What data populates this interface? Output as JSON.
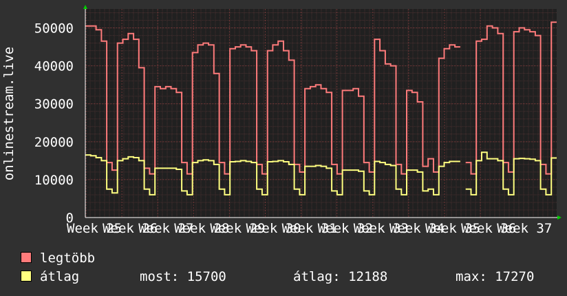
{
  "chart_data": {
    "type": "line",
    "ylabel": "onlinestream.live",
    "ylim": [
      0,
      55000
    ],
    "yticks": [
      0,
      10000,
      20000,
      30000,
      40000,
      50000
    ],
    "xticks": [
      "Week 25",
      "Week 26",
      "Week 27",
      "Week 28",
      "Week 29",
      "Week 30",
      "Week 31",
      "Week 32",
      "Week 33",
      "Week 34",
      "Week 35",
      "Week 36",
      "Week 37"
    ],
    "grid": true,
    "colors": {
      "background": "#303030",
      "plot_bg": "#202020",
      "grid_minor": "#4a3030",
      "grid_major": "#6a3434",
      "max_series": "#ff7b7b",
      "avg_series": "#ffff80",
      "arrow": "#00cc00"
    },
    "series": [
      {
        "name": "legtöbb",
        "color": "#ff7b7b",
        "values": [
          50500,
          50500,
          49500,
          46500,
          14500,
          12500,
          46000,
          47000,
          48500,
          47000,
          39500,
          13000,
          11500,
          34500,
          34000,
          34500,
          34000,
          33000,
          14500,
          11500,
          43500,
          45500,
          46000,
          45500,
          38000,
          14500,
          11500,
          44500,
          45000,
          45500,
          45000,
          44000,
          14000,
          11500,
          44000,
          45500,
          46500,
          44000,
          41500,
          14000,
          12000,
          34000,
          34500,
          35000,
          34000,
          33000,
          14000,
          11500,
          33500,
          33500,
          34000,
          32000,
          14500,
          12000,
          47000,
          44000,
          40500,
          40000,
          14000,
          11500,
          33500,
          33000,
          30500,
          13500,
          15500,
          12000,
          42000,
          44500,
          45500,
          45000,
          null,
          14500,
          11500,
          46500,
          47000,
          50500,
          50000,
          48500,
          14500,
          12000,
          49000,
          50000,
          49500,
          49000,
          48000,
          14000,
          11500,
          51500
        ]
      },
      {
        "name": "átlag",
        "color": "#ffff80",
        "values": [
          16500,
          16300,
          15800,
          15000,
          7500,
          6500,
          15000,
          15500,
          16000,
          15800,
          15000,
          7500,
          6000,
          13000,
          13000,
          13000,
          13000,
          12700,
          7000,
          6000,
          14500,
          15000,
          15200,
          15000,
          14000,
          7500,
          6000,
          14700,
          14800,
          15000,
          14800,
          14500,
          7500,
          6000,
          14700,
          14800,
          15000,
          14700,
          14000,
          7500,
          6000,
          13500,
          13500,
          13700,
          13500,
          13000,
          7000,
          6000,
          12500,
          12500,
          12500,
          12200,
          7000,
          6000,
          14800,
          14500,
          14000,
          13700,
          7500,
          6000,
          12500,
          12500,
          12000,
          7000,
          7500,
          6000,
          13500,
          14500,
          14800,
          14800,
          null,
          7500,
          6000,
          15000,
          17200,
          15500,
          15500,
          15000,
          7500,
          6000,
          15500,
          15600,
          15500,
          15400,
          15000,
          7500,
          6000,
          15700
        ]
      }
    ]
  },
  "legend": {
    "max_label": "legtöbb",
    "avg_label": "átlag",
    "now_label": "most:",
    "now_value": "15700",
    "avg_stat_label": "átlag:",
    "avg_stat_value": "12188",
    "max_stat_label": "max:",
    "max_stat_value": "17270"
  }
}
